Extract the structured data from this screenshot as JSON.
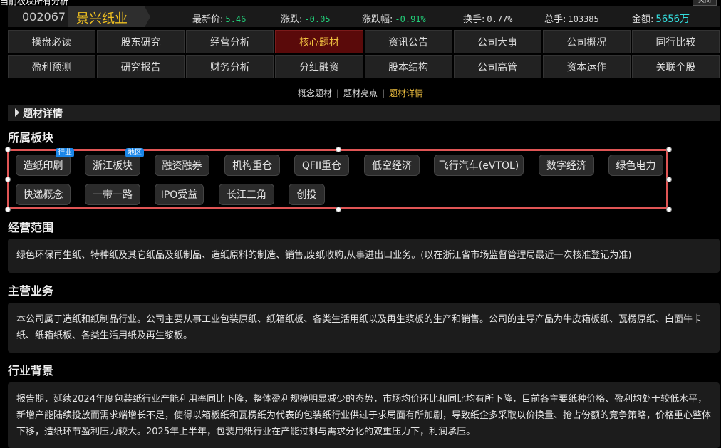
{
  "top_cut_text": "当前板块所有分析",
  "corner_label": "关闭",
  "stock": {
    "code": "002067",
    "name": "景兴纸业",
    "quotes": [
      {
        "label": "最新价:",
        "value": "5.46",
        "color": "#22d07a"
      },
      {
        "label": "涨跌:",
        "value": "-0.05",
        "color": "#22d07a"
      },
      {
        "label": "涨跌幅:",
        "value": "-0.91%",
        "color": "#22d07a"
      },
      {
        "label": "换手:",
        "value": "0.77%",
        "color": "#dddddd"
      },
      {
        "label": "总手:",
        "value": "103385",
        "color": "#dddddd"
      },
      {
        "label": "金额:",
        "value": "5656万",
        "color": "#33dddd"
      }
    ]
  },
  "nav": {
    "active": "核心题材",
    "items": [
      "操盘必读",
      "股东研究",
      "经营分析",
      "核心题材",
      "资讯公告",
      "公司大事",
      "公司概况",
      "同行比较",
      "盈利预测",
      "研究报告",
      "财务分析",
      "分红融资",
      "股本结构",
      "公司高管",
      "资本运作",
      "关联个股"
    ]
  },
  "subtabs": {
    "items": [
      "概念题材",
      "题材亮点",
      "题材详情"
    ],
    "separator": "|",
    "active": "题材详情"
  },
  "section_title": "题材详情",
  "sector": {
    "heading": "所属板块",
    "chips": [
      {
        "label": "造纸印刷",
        "badge": "行业"
      },
      {
        "label": "浙江板块",
        "badge": "地区"
      },
      {
        "label": "融资融券"
      },
      {
        "label": "机构重仓"
      },
      {
        "label": "QFII重仓"
      },
      {
        "label": "低空经济"
      },
      {
        "label": "飞行汽车(eVTOL)"
      },
      {
        "label": "数字经济"
      },
      {
        "label": "绿色电力"
      },
      {
        "label": "快递概念"
      },
      {
        "label": "一带一路"
      },
      {
        "label": "IPO受益"
      },
      {
        "label": "长江三角"
      },
      {
        "label": "创投"
      }
    ]
  },
  "scope": {
    "heading": "经营范围",
    "text": "绿色环保再生纸、特种纸及其它纸品及纸制品、造纸原料的制造、销售,废纸收购,从事进出口业务。(以在浙江省市场监督管理局最近一次核准登记为准)"
  },
  "main_business": {
    "heading": "主营业务",
    "text": "本公司属于造纸和纸制品行业。公司主要从事工业包装原纸、纸箱纸板、各类生活用纸以及再生浆板的生产和销售。公司的主导产品为牛皮箱板纸、瓦楞原纸、白面牛卡纸、纸箱纸板、各类生活用纸及再生浆板。"
  },
  "industry": {
    "heading": "行业背景",
    "text": "报告期，延续2024年度包装纸行业产能利用率同比下降，整体盈利规模明显减少的态势，市场均价环比和同比均有所下降，目前各主要纸种价格、盈利均处于较低水平，新增产能陆续投放而需求端增长不足，使得以箱板纸和瓦楞纸为代表的包装纸行业供过于求局面有所加剧，导致纸企多采取以价换量、抢占份额的竞争策略，价格重心整体下移，造纸环节盈利压力较大。2025年上半年，包装用纸行业在产能过剩与需求分化的双重压力下，利润承压。"
  }
}
